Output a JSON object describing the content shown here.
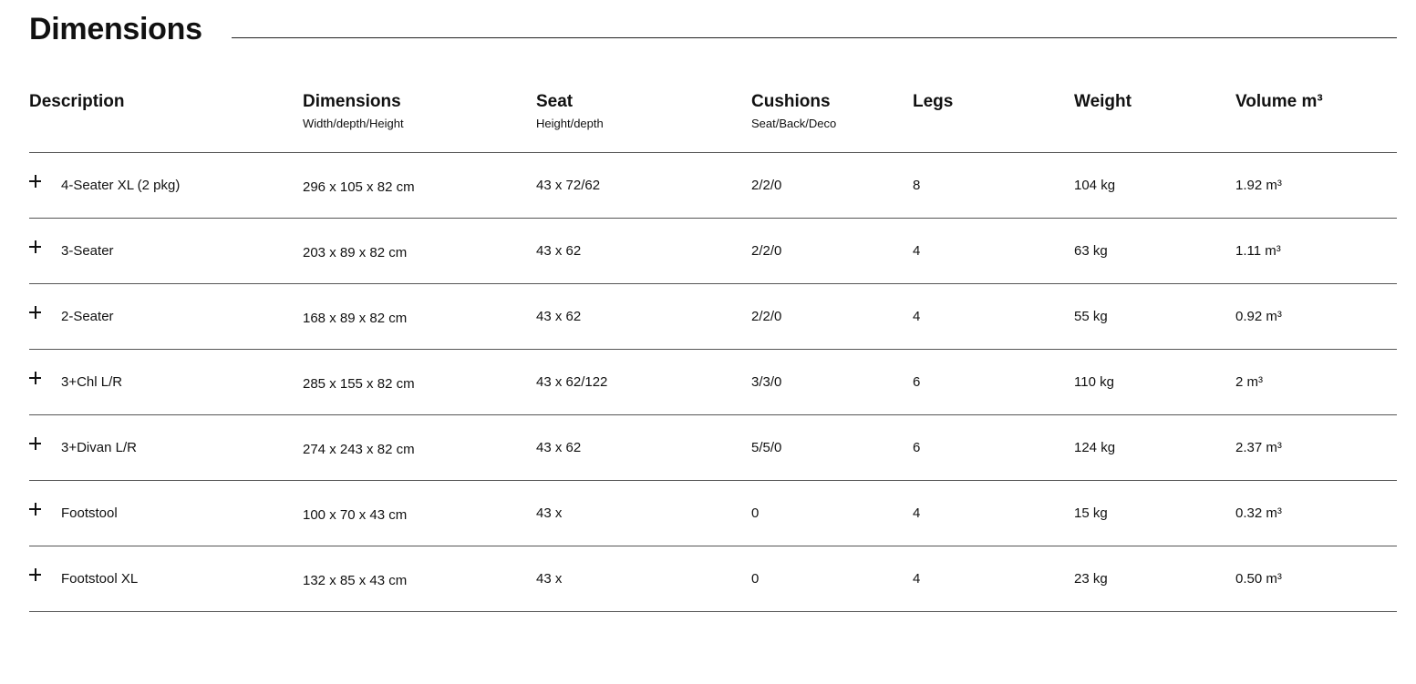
{
  "page": {
    "title": "Dimensions"
  },
  "table": {
    "headers": [
      {
        "label": "Description",
        "sub": ""
      },
      {
        "label": "Dimensions",
        "sub": "Width/depth/Height"
      },
      {
        "label": "Seat",
        "sub": "Height/depth"
      },
      {
        "label": "Cushions",
        "sub": "Seat/Back/Deco"
      },
      {
        "label": "Legs",
        "sub": ""
      },
      {
        "label": "Weight",
        "sub": ""
      },
      {
        "label": "Volume m³",
        "sub": ""
      }
    ],
    "rows": [
      {
        "description": "4-Seater XL (2 pkg)",
        "dimensions": "296 x 105 x 82 cm",
        "seat": "43 x 72/62",
        "cushions": "2/2/0",
        "legs": "8",
        "weight": "104 kg",
        "volume": "1.92 m³"
      },
      {
        "description": "3-Seater",
        "dimensions": "203 x 89 x 82 cm",
        "seat": "43 x 62",
        "cushions": "2/2/0",
        "legs": "4",
        "weight": "63 kg",
        "volume": "1.11 m³"
      },
      {
        "description": "2-Seater",
        "dimensions": "168 x 89 x 82 cm",
        "seat": "43 x 62",
        "cushions": "2/2/0",
        "legs": "4",
        "weight": "55 kg",
        "volume": "0.92 m³"
      },
      {
        "description": "3+Chl L/R",
        "dimensions": "285 x 155 x 82 cm",
        "seat": "43 x 62/122",
        "cushions": "3/3/0",
        "legs": "6",
        "weight": "110 kg",
        "volume": "2 m³"
      },
      {
        "description": "3+Divan L/R",
        "dimensions": "274 x 243 x 82 cm",
        "seat": "43 x 62",
        "cushions": "5/5/0",
        "legs": "6",
        "weight": "124 kg",
        "volume": "2.37 m³"
      },
      {
        "description": "Footstool",
        "dimensions": "100 x 70 x 43 cm",
        "seat": "43 x",
        "cushions": "0",
        "legs": "4",
        "weight": "15 kg",
        "volume": "0.32 m³"
      },
      {
        "description": "Footstool XL",
        "dimensions": "132 x 85 x 43 cm",
        "seat": "43 x",
        "cushions": "0",
        "legs": "4",
        "weight": "23 kg",
        "volume": "0.50 m³"
      }
    ]
  },
  "icons": {
    "expand": "plus-icon"
  }
}
